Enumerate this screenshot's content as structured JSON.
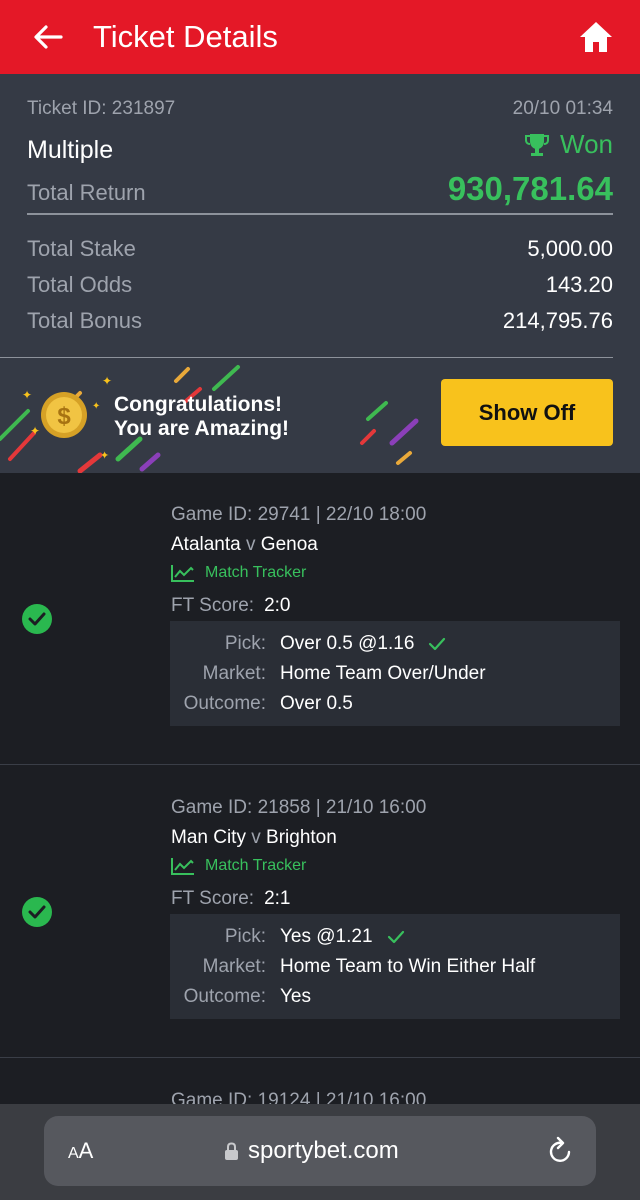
{
  "header": {
    "title": "Ticket Details"
  },
  "ticket": {
    "id": "Ticket ID: 231897",
    "datetime": "20/10 01:34",
    "type": "Multiple",
    "status": "Won",
    "total_return_label": "Total Return",
    "total_return": "930,781.64",
    "stake_label": "Total Stake",
    "stake": "5,000.00",
    "odds_label": "Total Odds",
    "odds": "143.20",
    "bonus_label": "Total Bonus",
    "bonus": "214,795.76"
  },
  "banner": {
    "line1": "Congratulations!",
    "line2": "You are Amazing!",
    "button": "Show Off"
  },
  "labels": {
    "match_tracker": "Match Tracker",
    "ft_score": "FT Score:",
    "pick": "Pick:",
    "market": "Market:",
    "outcome": "Outcome:",
    "vs": "v"
  },
  "selections": [
    {
      "game": "Game ID: 29741 | 22/10 18:00",
      "home": "Atalanta",
      "away": "Genoa",
      "score": "2:0",
      "pick": "Over 0.5 @1.16",
      "market": "Home Team Over/Under",
      "outcome": "Over 0.5"
    },
    {
      "game": "Game ID: 21858 | 21/10 16:00",
      "home": "Man City",
      "away": "Brighton",
      "score": "2:1",
      "pick": "Yes @1.21",
      "market": "Home Team to Win Either Half",
      "outcome": "Yes"
    },
    {
      "game": "Game ID: 19124 | 21/10 16:00"
    }
  ],
  "browser": {
    "aa_small": "A",
    "aa_large": "A",
    "url": "sportybet.com"
  },
  "colors": {
    "header_red": "#e41827",
    "won_green": "#38c05d",
    "button_yellow": "#f8c21c"
  }
}
